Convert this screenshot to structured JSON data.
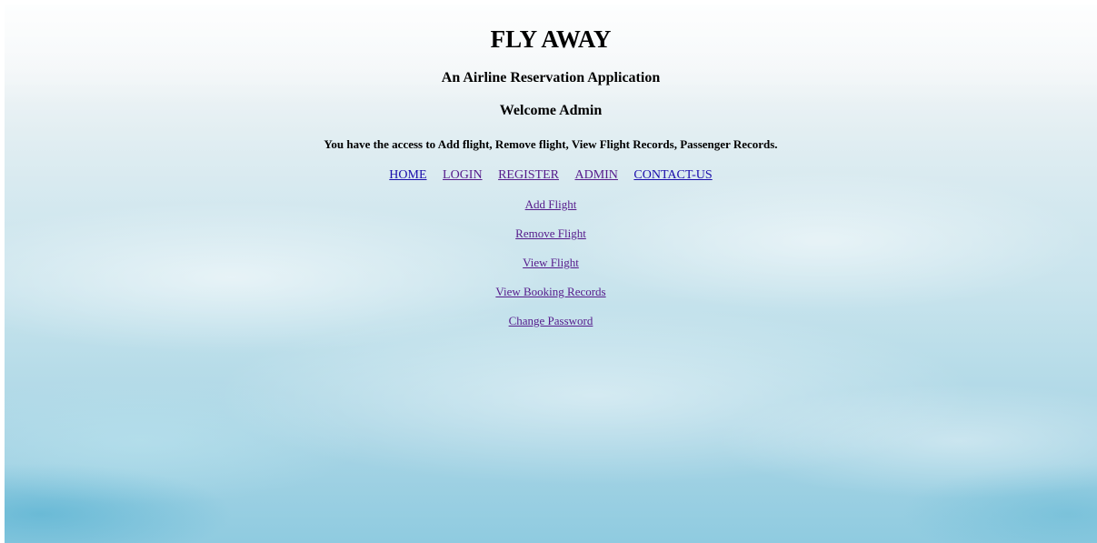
{
  "header": {
    "title": "FLY AWAY",
    "subtitle": "An Airline Reservation Application",
    "welcome": "Welcome Admin",
    "access_text": "You have the access to Add flight, Remove flight, View Flight Records, Passenger Records."
  },
  "nav": {
    "home": "HOME",
    "login": "LOGIN",
    "register": "REGISTER",
    "admin": "ADMIN",
    "contact": "CONTACT-US"
  },
  "admin_menu": {
    "add_flight": "Add Flight",
    "remove_flight": "Remove Flight",
    "view_flight": "View Flight",
    "view_booking_records": "View Booking Records",
    "change_password": "Change Password"
  },
  "colors": {
    "link": "#1a0dab",
    "visited_link": "#551a8b",
    "background_sky": "#c9e4ed"
  }
}
